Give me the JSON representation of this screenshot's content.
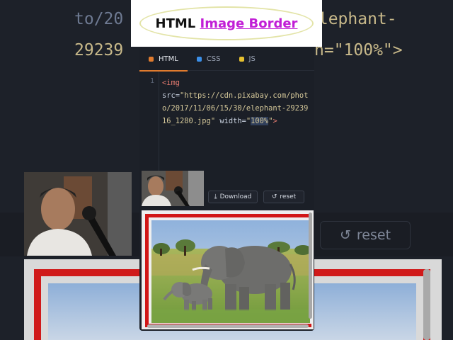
{
  "title": {
    "prefix": "HTML ",
    "accent": "Image Border"
  },
  "editor": {
    "tabs": [
      {
        "label": "HTML",
        "color": "#e07b2e",
        "active": true
      },
      {
        "label": "CSS",
        "color": "#3b8fe8",
        "active": false
      },
      {
        "label": "JS",
        "color": "#e6c02f",
        "active": false
      }
    ],
    "line_number": "1",
    "code": {
      "open": "<img",
      "src_attr": "src=",
      "src_value": "\"https://cdn.pixabay.com/photo/2017/11/06/15/30/elephant-2923916_1280.jpg\"",
      "width_attr": "width=",
      "quote_open": "\"",
      "width_value": "100%",
      "quote_close": "\"",
      "close": ">"
    }
  },
  "toolbar": {
    "download_label": "Download",
    "reset_label": "reset"
  },
  "background": {
    "line1": "to/20",
    "line1_right": "elephant-",
    "line2": "29239",
    "line2_right": "h=\"100%\">",
    "reset_label": "reset"
  },
  "colors": {
    "border_red": "#d11717",
    "accent_purple": "#c11ed6",
    "html_tab": "#e07b2e",
    "css_tab": "#3b8fe8",
    "js_tab": "#e6c02f"
  }
}
